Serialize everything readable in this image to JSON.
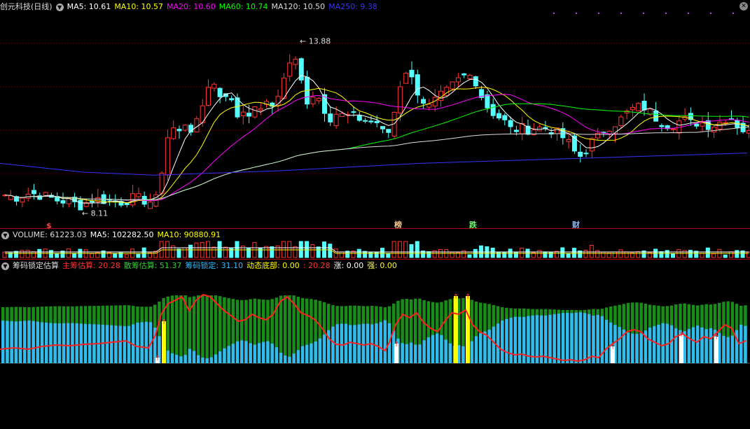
{
  "main_panel": {
    "title": "创元科技(日线)",
    "ma": [
      {
        "label": "MA5: 10.61",
        "color": "#ffffff"
      },
      {
        "label": "MA10: 10.57",
        "color": "#ffff00"
      },
      {
        "label": "MA20: 10.60",
        "color": "#ff00ff"
      },
      {
        "label": "MA60: 10.74",
        "color": "#00ff00"
      },
      {
        "label": "MA120: 10.50",
        "color": "#dddddd"
      },
      {
        "label": "MA250: 9.38",
        "color": "#3333ff"
      }
    ],
    "high_label": "13.88",
    "low_label": "8.11",
    "event_tags": [
      {
        "text": "$",
        "color": "#ff4040"
      },
      {
        "text": "榜",
        "color": "#ffcc88"
      },
      {
        "text": "跌",
        "color": "#66ff66"
      },
      {
        "text": "财",
        "color": "#88bbff"
      }
    ]
  },
  "volume_panel": {
    "title": "VOLUME: 61223.03",
    "ma5": "MA5: 102282.50",
    "ma10": "MA10: 90880.91"
  },
  "indicator_panel": {
    "name": "筹码锁定估算",
    "items": [
      {
        "label": "主筹估算: 20.28",
        "color": "#ff3333"
      },
      {
        "label": "散筹估算: 51.37",
        "color": "#33cc33"
      },
      {
        "label": "筹码锁定: 31.10",
        "color": "#33bbff"
      },
      {
        "label": "动态底部: 0.00",
        "color": "#ffff00"
      },
      {
        "label": ": 20.28",
        "color": "#ff3333"
      },
      {
        "label": "涨: 0.00",
        "color": "#ffffff"
      },
      {
        "label": "强: 0.00",
        "color": "#ffff00"
      }
    ]
  },
  "chart_data": {
    "type": "candlestick",
    "title": "创元科技(日线)",
    "ylim": [
      7.6,
      14.6
    ],
    "price_high": 13.88,
    "price_low": 8.11,
    "price_path": [
      [
        0,
        8.55
      ],
      [
        20,
        8.45
      ],
      [
        40,
        8.6
      ],
      [
        60,
        8.5
      ],
      [
        80,
        8.35
      ],
      [
        100,
        8.3
      ],
      [
        110,
        8.15
      ],
      [
        130,
        8.4
      ],
      [
        150,
        8.35
      ],
      [
        170,
        8.3
      ],
      [
        190,
        8.45
      ],
      [
        210,
        8.3
      ],
      [
        222,
        8.4
      ],
      [
        232,
        10.0
      ],
      [
        240,
        10.9
      ],
      [
        252,
        10.6
      ],
      [
        262,
        11.0
      ],
      [
        272,
        10.7
      ],
      [
        282,
        11.1
      ],
      [
        292,
        12.2
      ],
      [
        300,
        12.4
      ],
      [
        310,
        11.9
      ],
      [
        322,
        12.0
      ],
      [
        335,
        11.2
      ],
      [
        345,
        11.4
      ],
      [
        358,
        11.3
      ],
      [
        372,
        11.6
      ],
      [
        385,
        11.5
      ],
      [
        395,
        12.0
      ],
      [
        405,
        12.6
      ],
      [
        413,
        13.2
      ],
      [
        420,
        13.0
      ],
      [
        428,
        12.3
      ],
      [
        436,
        11.7
      ],
      [
        446,
        12.0
      ],
      [
        456,
        11.7
      ],
      [
        466,
        11.1
      ],
      [
        476,
        11.3
      ],
      [
        488,
        11.2
      ],
      [
        500,
        11.2
      ],
      [
        512,
        11.1
      ],
      [
        524,
        11.0
      ],
      [
        535,
        11.0
      ],
      [
        547,
        10.5
      ],
      [
        556,
        10.8
      ],
      [
        565,
        12.0
      ],
      [
        575,
        12.8
      ],
      [
        586,
        12.4
      ],
      [
        598,
        11.8
      ],
      [
        610,
        11.5
      ],
      [
        622,
        11.8
      ],
      [
        634,
        12.0
      ],
      [
        646,
        12.3
      ],
      [
        656,
        12.5
      ],
      [
        666,
        12.6
      ],
      [
        676,
        12.4
      ],
      [
        686,
        11.8
      ],
      [
        696,
        11.4
      ],
      [
        708,
        11.2
      ],
      [
        718,
        11.0
      ],
      [
        728,
        10.7
      ],
      [
        740,
        10.8
      ],
      [
        752,
        10.75
      ],
      [
        764,
        10.8
      ],
      [
        776,
        10.8
      ],
      [
        788,
        10.7
      ],
      [
        800,
        10.5
      ],
      [
        812,
        10.2
      ],
      [
        822,
        9.8
      ],
      [
        830,
        9.9
      ],
      [
        840,
        10.3
      ],
      [
        852,
        10.5
      ],
      [
        862,
        10.8
      ],
      [
        872,
        10.9
      ],
      [
        884,
        11.1
      ],
      [
        896,
        11.4
      ],
      [
        908,
        11.5
      ],
      [
        918,
        11.5
      ],
      [
        930,
        11.2
      ],
      [
        942,
        11.0
      ],
      [
        952,
        10.9
      ],
      [
        962,
        10.95
      ],
      [
        972,
        11.1
      ],
      [
        984,
        10.95
      ],
      [
        996,
        11.0
      ],
      [
        1008,
        10.9
      ],
      [
        1020,
        10.9
      ],
      [
        1030,
        11.1
      ],
      [
        1040,
        11.2
      ],
      [
        1050,
        10.9
      ],
      [
        1060,
        10.7
      ],
      [
        1067,
        10.6
      ]
    ],
    "ma250_path": [
      [
        0,
        9.6
      ],
      [
        120,
        9.3
      ],
      [
        220,
        9.2
      ],
      [
        400,
        9.35
      ],
      [
        600,
        9.6
      ],
      [
        800,
        9.75
      ],
      [
        1067,
        9.95
      ]
    ],
    "volume_ylim": [
      0,
      1
    ],
    "indicator_ylim": [
      -100,
      100
    ],
    "main_chip_path": [
      [
        0,
        20
      ],
      [
        20,
        22
      ],
      [
        40,
        20
      ],
      [
        60,
        24
      ],
      [
        80,
        26
      ],
      [
        100,
        25
      ],
      [
        120,
        27
      ],
      [
        140,
        28
      ],
      [
        160,
        30
      ],
      [
        180,
        32
      ],
      [
        195,
        24
      ],
      [
        212,
        22
      ],
      [
        222,
        40
      ],
      [
        230,
        70
      ],
      [
        240,
        85
      ],
      [
        250,
        90
      ],
      [
        260,
        95
      ],
      [
        270,
        75
      ],
      [
        280,
        90
      ],
      [
        290,
        98
      ],
      [
        300,
        95
      ],
      [
        310,
        85
      ],
      [
        320,
        75
      ],
      [
        330,
        68
      ],
      [
        340,
        60
      ],
      [
        350,
        62
      ],
      [
        360,
        70
      ],
      [
        370,
        65
      ],
      [
        380,
        62
      ],
      [
        390,
        70
      ],
      [
        400,
        88
      ],
      [
        410,
        95
      ],
      [
        420,
        85
      ],
      [
        430,
        72
      ],
      [
        440,
        68
      ],
      [
        450,
        62
      ],
      [
        460,
        50
      ],
      [
        470,
        35
      ],
      [
        480,
        27
      ],
      [
        490,
        26
      ],
      [
        500,
        30
      ],
      [
        510,
        28
      ],
      [
        520,
        26
      ],
      [
        530,
        28
      ],
      [
        540,
        24
      ],
      [
        550,
        18
      ],
      [
        556,
        30
      ],
      [
        565,
        55
      ],
      [
        575,
        70
      ],
      [
        585,
        65
      ],
      [
        595,
        72
      ],
      [
        605,
        58
      ],
      [
        615,
        50
      ],
      [
        625,
        45
      ],
      [
        635,
        60
      ],
      [
        645,
        72
      ],
      [
        655,
        70
      ],
      [
        665,
        76
      ],
      [
        675,
        55
      ],
      [
        685,
        45
      ],
      [
        695,
        40
      ],
      [
        705,
        30
      ],
      [
        715,
        20
      ],
      [
        725,
        15
      ],
      [
        735,
        12
      ],
      [
        745,
        13
      ],
      [
        755,
        10
      ],
      [
        765,
        9
      ],
      [
        775,
        10
      ],
      [
        785,
        8
      ],
      [
        795,
        6
      ],
      [
        805,
        4
      ],
      [
        815,
        5
      ],
      [
        825,
        3
      ],
      [
        835,
        5
      ],
      [
        845,
        10
      ],
      [
        855,
        8
      ],
      [
        865,
        20
      ],
      [
        875,
        28
      ],
      [
        885,
        35
      ],
      [
        895,
        45
      ],
      [
        905,
        48
      ],
      [
        915,
        45
      ],
      [
        925,
        35
      ],
      [
        935,
        30
      ],
      [
        945,
        25
      ],
      [
        955,
        28
      ],
      [
        965,
        38
      ],
      [
        975,
        42
      ],
      [
        985,
        35
      ],
      [
        995,
        30
      ],
      [
        1005,
        38
      ],
      [
        1015,
        35
      ],
      [
        1025,
        45
      ],
      [
        1035,
        55
      ],
      [
        1045,
        50
      ],
      [
        1055,
        28
      ],
      [
        1065,
        32
      ]
    ],
    "series": [
      {
        "name": "主筹估算",
        "value": 20.28
      },
      {
        "name": "散筹估算",
        "value": 51.37
      },
      {
        "name": "筹码锁定",
        "value": 31.1
      },
      {
        "name": "动态底部",
        "value": 0.0
      }
    ]
  }
}
